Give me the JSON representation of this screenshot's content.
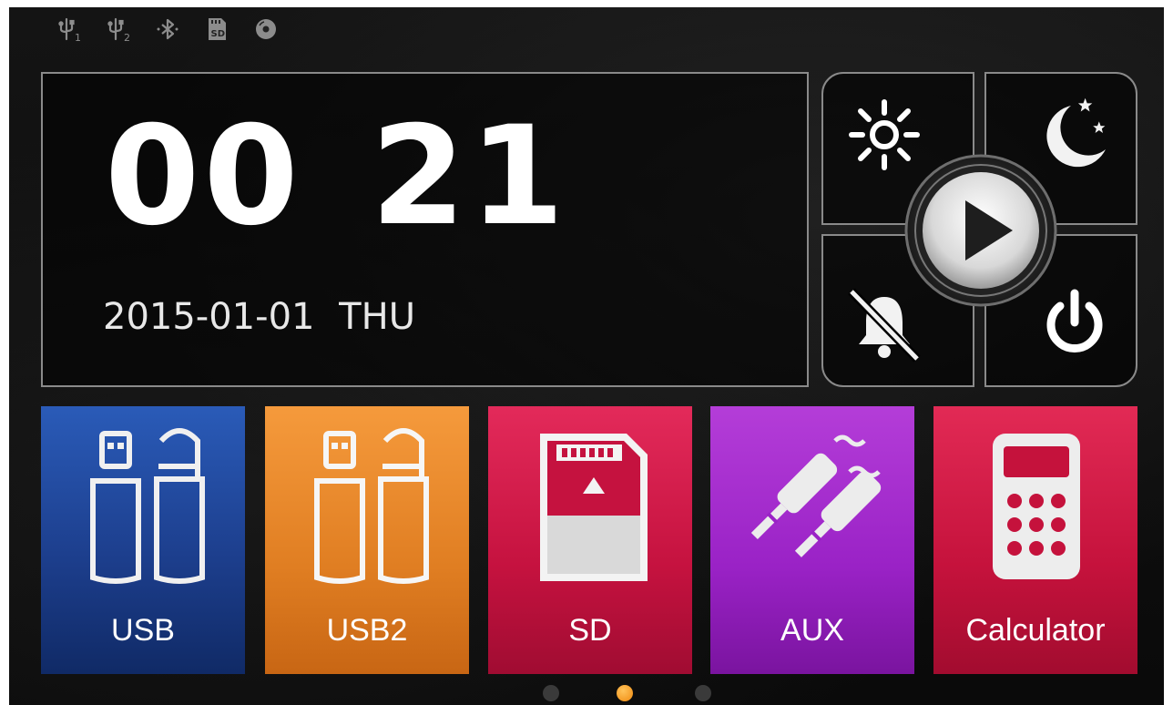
{
  "status_bar": {
    "icons": [
      "usb1-icon",
      "usb2-icon",
      "bluetooth-icon",
      "sd-card-icon",
      "disc-icon"
    ],
    "usb1_sub": "1",
    "usb2_sub": "2",
    "sd_text": "SD"
  },
  "clock": {
    "hours": "00",
    "minutes": "21",
    "date": "2015-01-01 THU"
  },
  "quick_controls": {
    "icons": [
      "brightness-icon",
      "night-mode-icon",
      "mute-alarm-icon",
      "power-icon",
      "play-icon"
    ]
  },
  "apps": [
    {
      "label": "USB",
      "icon": "usb-drives-icon",
      "color": "#1d3f8e"
    },
    {
      "label": "USB2",
      "icon": "usb-drives-icon",
      "color": "#e07e22"
    },
    {
      "label": "SD",
      "icon": "sd-card-icon",
      "color": "#c5123f"
    },
    {
      "label": "AUX",
      "icon": "aux-cable-icon",
      "color": "#9a22c6"
    },
    {
      "label": "Calculator",
      "icon": "calculator-icon",
      "color": "#c5123c"
    }
  ],
  "pager": {
    "pages": 3,
    "active_page": 2,
    "active_color": "#f08a10"
  }
}
